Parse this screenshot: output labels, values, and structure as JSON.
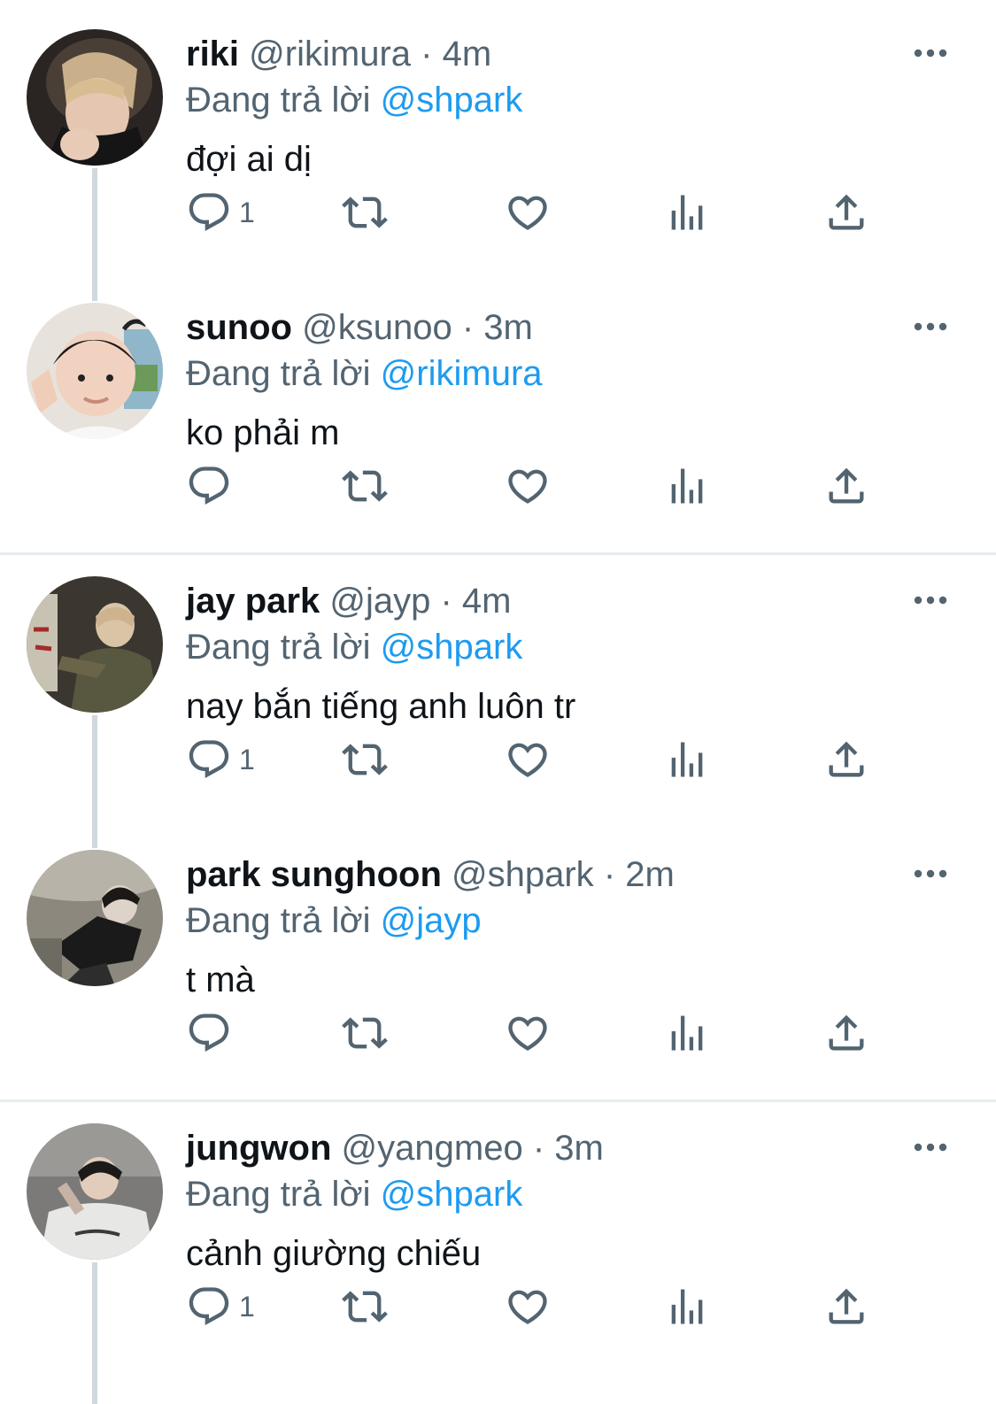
{
  "reply_prefix": "Đang trả lời",
  "colors": {
    "accent": "#1d9bf0",
    "secondary": "#536471",
    "text": "#0f1419",
    "thread_line": "#cfd9de"
  },
  "tweets": [
    {
      "name": "riki",
      "handle": "@rikimura",
      "dot": "·",
      "time": "4m",
      "reply_to": "@shpark",
      "text": "đợi ai dị",
      "reply_count": "1"
    },
    {
      "name": "sunoo",
      "handle": "@ksunoo",
      "dot": "·",
      "time": "3m",
      "reply_to": "@rikimura",
      "text": "ko phải m",
      "reply_count": ""
    },
    {
      "name": "jay park",
      "handle": "@jayp",
      "dot": "·",
      "time": "4m",
      "reply_to": "@shpark",
      "text": "nay bắn tiếng anh luôn tr",
      "reply_count": "1"
    },
    {
      "name": "park sunghoon",
      "handle": "@shpark",
      "dot": "·",
      "time": "2m",
      "reply_to": "@jayp",
      "text": "t mà",
      "reply_count": ""
    },
    {
      "name": "jungwon",
      "handle": "@yangmeo",
      "dot": "·",
      "time": "3m",
      "reply_to": "@shpark",
      "text": "cảnh giường chiếu",
      "reply_count": "1"
    }
  ],
  "icons": {
    "reply": "reply-icon",
    "retweet": "retweet-icon",
    "like": "heart-icon",
    "views": "views-icon",
    "share": "share-icon",
    "more": "more-icon"
  }
}
